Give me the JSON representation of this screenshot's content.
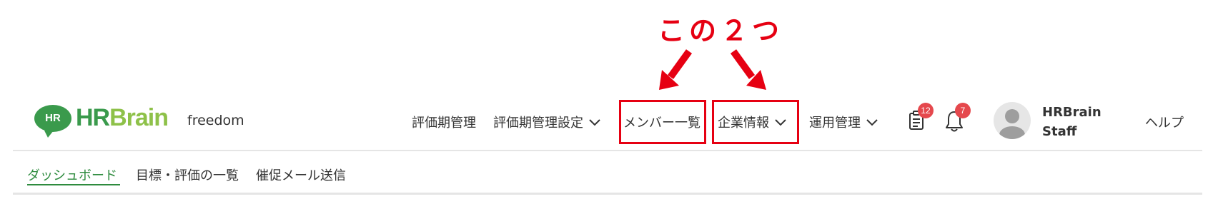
{
  "annotation": {
    "text": "この２つ",
    "color": "#e60012"
  },
  "header": {
    "logo": {
      "badge": "HR",
      "name_part1": "HR",
      "name_part2": "Brain"
    },
    "tenant": "freedom",
    "nav": [
      {
        "label": "評価期管理",
        "dropdown": false
      },
      {
        "label": "評価期管理設定",
        "dropdown": true
      },
      {
        "label": "メンバー一覧",
        "dropdown": false,
        "highlighted": true
      },
      {
        "label": "企業情報",
        "dropdown": true,
        "highlighted": true
      },
      {
        "label": "運用管理",
        "dropdown": true
      }
    ],
    "tasks_badge": "12",
    "notifications_badge": "7",
    "user": {
      "line1": "HRBrain",
      "line2": "Staff"
    },
    "help": "ヘルプ"
  },
  "subnav": [
    {
      "label": "ダッシュボード",
      "active": true
    },
    {
      "label": "目標・評価の一覧",
      "active": false
    },
    {
      "label": "催促メール送信",
      "active": false
    }
  ],
  "colors": {
    "brand_green": "#3a9a4c",
    "brand_light_green": "#8ec149",
    "badge_red": "#e5484d",
    "active_green": "#2e8b3e"
  }
}
